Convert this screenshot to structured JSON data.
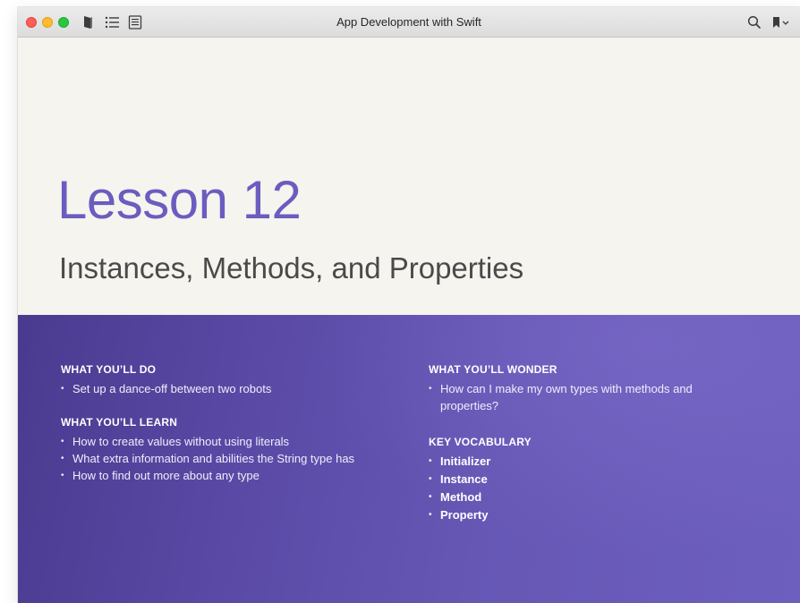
{
  "window": {
    "title": "App Development with Swift"
  },
  "toolbar": {
    "left_icons": [
      "book-icon",
      "list-icon",
      "notes-icon"
    ],
    "right_icons": [
      "search-icon",
      "bookmark-icon",
      "chevron-down-icon"
    ]
  },
  "lesson": {
    "heading": "Lesson 12",
    "subtitle": "Instances, Methods, and Properties"
  },
  "do": {
    "heading": "WHAT YOU’LL DO",
    "items": [
      "Set up a dance-off between two robots"
    ]
  },
  "learn": {
    "heading": "WHAT YOU’LL LEARN",
    "items": [
      "How to create values without using literals",
      "What extra information and abilities the String type has",
      "How to find out more about any type"
    ]
  },
  "wonder": {
    "heading": "WHAT YOU’LL WONDER",
    "items": [
      "How can I make my own types with methods and properties?"
    ]
  },
  "vocab": {
    "heading": "KEY VOCABULARY",
    "items": [
      "Initializer",
      "Instance",
      "Method",
      "Property"
    ]
  },
  "colors": {
    "accent": "#6b5cc0",
    "panel": "#5a4aa6",
    "page": "#f5f4ee"
  }
}
